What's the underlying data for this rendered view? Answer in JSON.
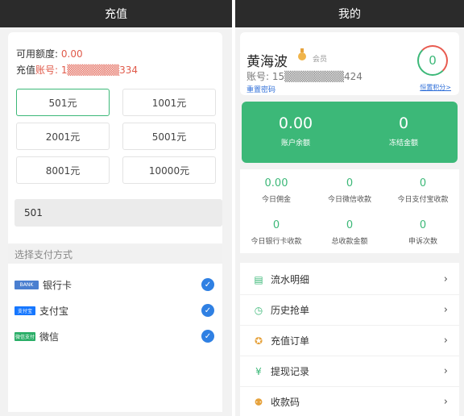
{
  "colors": {
    "accent": "#3cb878",
    "header": "#2b2b2b",
    "link": "#2f6fd8",
    "check": "#2f80e3"
  },
  "left": {
    "title": "充值",
    "available_label": "可用额度:",
    "available_value": "0.00",
    "account_label_a": "充值",
    "account_label_b": "账号:",
    "account_value": "1▒▒▒▒▒▒▒334",
    "amounts": [
      "501元",
      "1001元",
      "2001元",
      "5001元",
      "8001元",
      "10000元"
    ],
    "selected_amount_index": 0,
    "amount_input": "501",
    "pay_section_title": "选择支付方式",
    "pay_methods": [
      {
        "logo": "BANK",
        "label": "银行卡",
        "icon": "bank-card-icon",
        "color": "#4a7fd0",
        "checked": true
      },
      {
        "logo": "支付宝",
        "label": "支付宝",
        "icon": "alipay-icon",
        "color": "#1677ff",
        "checked": true
      },
      {
        "logo": "微信支付",
        "label": "微信",
        "icon": "wechat-icon",
        "color": "#2aae67",
        "checked": true
      }
    ]
  },
  "right": {
    "title": "我的",
    "name": "黄海波",
    "member": "会员",
    "account": "账号: 15▒▒▒▒▒▒▒▒424",
    "reset_password": "重置密码",
    "points": "0",
    "reset_points": "恒置积分>",
    "balance": "0.00",
    "balance_label": "账户余额",
    "frozen": "0",
    "frozen_label": "冻结金额",
    "stats": [
      {
        "value": "0.00",
        "label": "今日佣金"
      },
      {
        "value": "0",
        "label": "今日微信收款"
      },
      {
        "value": "0",
        "label": "今日支付宝收款"
      },
      {
        "value": "0",
        "label": "今日银行卡收款"
      },
      {
        "value": "0",
        "label": "总收款金额"
      },
      {
        "value": "0",
        "label": "申诉次数"
      }
    ],
    "menu": [
      {
        "label": "流水明细",
        "icon": "ledger-icon",
        "glyph": "▤"
      },
      {
        "label": "历史抢单",
        "icon": "clock-icon",
        "glyph": "◷"
      },
      {
        "label": "充值订单",
        "icon": "recharge-icon",
        "glyph": "✪"
      },
      {
        "label": "提现记录",
        "icon": "withdraw-icon",
        "glyph": "¥"
      },
      {
        "label": "收款码",
        "icon": "qrcode-user-icon",
        "glyph": "⚉"
      }
    ]
  }
}
